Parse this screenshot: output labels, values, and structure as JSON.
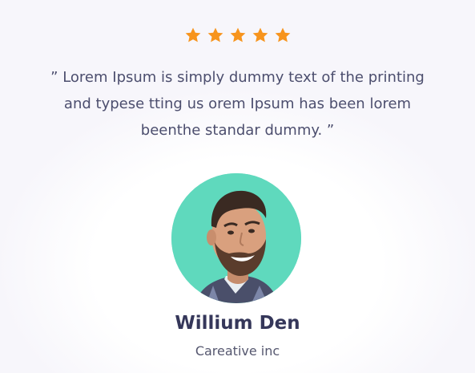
{
  "rating": {
    "value": 5,
    "max": 5,
    "star_color": "#f7941d",
    "icon": "star-icon"
  },
  "testimonial": {
    "quote_lines": [
      "” Lorem Ipsum is simply dummy text of the printing",
      "and typese tting us orem Ipsum has been lorem",
      "beenthe standar dummy. ”"
    ],
    "author_name": "Willium Den",
    "author_company": "Careative inc"
  },
  "colors": {
    "avatar_background": "#5fd9bd",
    "text": "#4c4e6e",
    "name": "#35375a"
  }
}
